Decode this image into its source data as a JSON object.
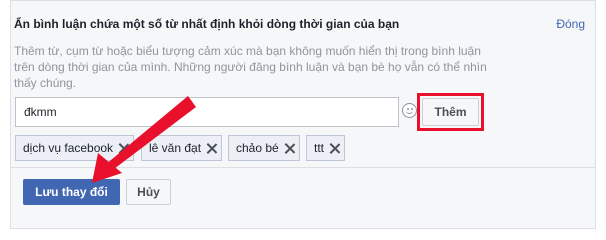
{
  "panel": {
    "title": "Ẩn bình luận chứa một số từ nhất định khỏi dòng thời gian của bạn",
    "close_label": "Đóng",
    "description": "Thêm từ, cụm từ hoặc biểu tượng cảm xúc mà bạn không muốn hiển thị trong bình luận trên dòng thời gian của mình. Những người đăng bình luận và bạn bè họ vẫn có thể nhìn thấy chúng."
  },
  "input": {
    "value": "đkmm"
  },
  "add_button": {
    "label": "Thêm"
  },
  "tags": [
    {
      "label": "dịch vụ facebook"
    },
    {
      "label": "lê văn đạt"
    },
    {
      "label": "chảo bé"
    },
    {
      "label": "ttt"
    }
  ],
  "actions": {
    "save_label": "Lưu thay đổi",
    "cancel_label": "Hủy"
  },
  "colors": {
    "accent": "#4267b2",
    "highlight": "#e8102b"
  }
}
